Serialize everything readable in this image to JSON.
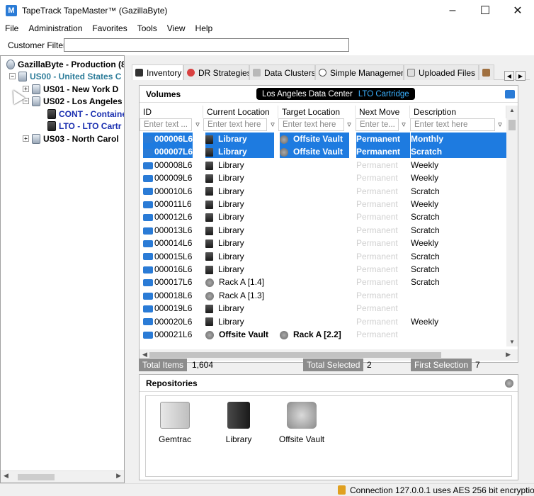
{
  "window": {
    "title": "TapeTrack TapeMaster™ (GazillaByte)"
  },
  "menu": [
    "File",
    "Administration",
    "Favorites",
    "Tools",
    "View",
    "Help"
  ],
  "customer_filter": {
    "label": "Customer Filter",
    "value": ""
  },
  "tree": [
    {
      "label": "GazillaByte - Production (8",
      "icon": "server-icon"
    },
    {
      "label": "US00 - United States C",
      "icon": "database-icon"
    },
    {
      "label": "US01 - New York D",
      "icon": "database-icon"
    },
    {
      "label": "US02 - Los Angeles",
      "icon": "database-icon"
    },
    {
      "label": "CONT - Containe",
      "icon": "tape-icon"
    },
    {
      "label": "LTO - LTO Cartr",
      "icon": "tape-icon"
    },
    {
      "label": "US03 - North Carol",
      "icon": "database-icon"
    }
  ],
  "tabs": [
    {
      "label": "Inventory",
      "icon": "inventory-icon"
    },
    {
      "label": "DR Strategies",
      "icon": "lifebuoy-icon"
    },
    {
      "label": "Data Clusters",
      "icon": "cluster-icon"
    },
    {
      "label": "Simple Management",
      "icon": "search-icon"
    },
    {
      "label": "Uploaded Files",
      "icon": "file-icon"
    }
  ],
  "volumes": {
    "title": "Volumes",
    "badge_location": "Los Angeles Data Center",
    "badge_media": "LTO Cartridge",
    "columns": [
      "ID",
      "Current Location",
      "Target Location",
      "Next Move",
      "Description"
    ],
    "filter_placeholders": [
      "Enter text ...",
      "Enter text here",
      "Enter text here",
      "Enter te...",
      "Enter text here"
    ],
    "rows": [
      {
        "id": "000006L6",
        "current": "Library",
        "target": "Offsite Vault",
        "next": "Permanent",
        "desc": "Monthly"
      },
      {
        "id": "000007L6",
        "current": "Library",
        "target": "Offsite Vault",
        "next": "Permanent",
        "desc": "Scratch"
      },
      {
        "id": "000008L6",
        "current": "Library",
        "target": "",
        "next": "Permanent",
        "desc": "Weekly"
      },
      {
        "id": "000009L6",
        "current": "Library",
        "target": "",
        "next": "Permanent",
        "desc": "Weekly"
      },
      {
        "id": "000010L6",
        "current": "Library",
        "target": "",
        "next": "Permanent",
        "desc": "Scratch"
      },
      {
        "id": "000011L6",
        "current": "Library",
        "target": "",
        "next": "Permanent",
        "desc": "Weekly"
      },
      {
        "id": "000012L6",
        "current": "Library",
        "target": "",
        "next": "Permanent",
        "desc": "Scratch"
      },
      {
        "id": "000013L6",
        "current": "Library",
        "target": "",
        "next": "Permanent",
        "desc": "Scratch"
      },
      {
        "id": "000014L6",
        "current": "Library",
        "target": "",
        "next": "Permanent",
        "desc": "Weekly"
      },
      {
        "id": "000015L6",
        "current": "Library",
        "target": "",
        "next": "Permanent",
        "desc": "Scratch"
      },
      {
        "id": "000016L6",
        "current": "Library",
        "target": "",
        "next": "Permanent",
        "desc": "Scratch"
      },
      {
        "id": "000017L6",
        "current": "Rack A [1.4]",
        "target": "",
        "next": "Permanent",
        "desc": "Scratch"
      },
      {
        "id": "000018L6",
        "current": "Rack A [1.3]",
        "target": "",
        "next": "Permanent",
        "desc": ""
      },
      {
        "id": "000019L6",
        "current": "Library",
        "target": "",
        "next": "Permanent",
        "desc": ""
      },
      {
        "id": "000020L6",
        "current": "Library",
        "target": "",
        "next": "Permanent",
        "desc": "Weekly"
      },
      {
        "id": "000021L6",
        "current": "Offsite Vault",
        "target": "Rack A [2.2]",
        "next": "Permanent",
        "desc": ""
      }
    ]
  },
  "stats": {
    "total_items_label": "Total Items",
    "total_items": "1,604",
    "total_selected_label": "Total Selected",
    "total_selected": "2",
    "first_selection_label": "First Selection",
    "first_selection": "7"
  },
  "repositories": {
    "title": "Repositories",
    "items": [
      {
        "label": "Gemtrac",
        "icon": "cabinet-icon"
      },
      {
        "label": "Library",
        "icon": "library-icon"
      },
      {
        "label": "Offsite Vault",
        "icon": "vault-icon"
      }
    ]
  },
  "status": {
    "text": "Connection 127.0.0.1 uses AES 256 bit encryptio"
  }
}
